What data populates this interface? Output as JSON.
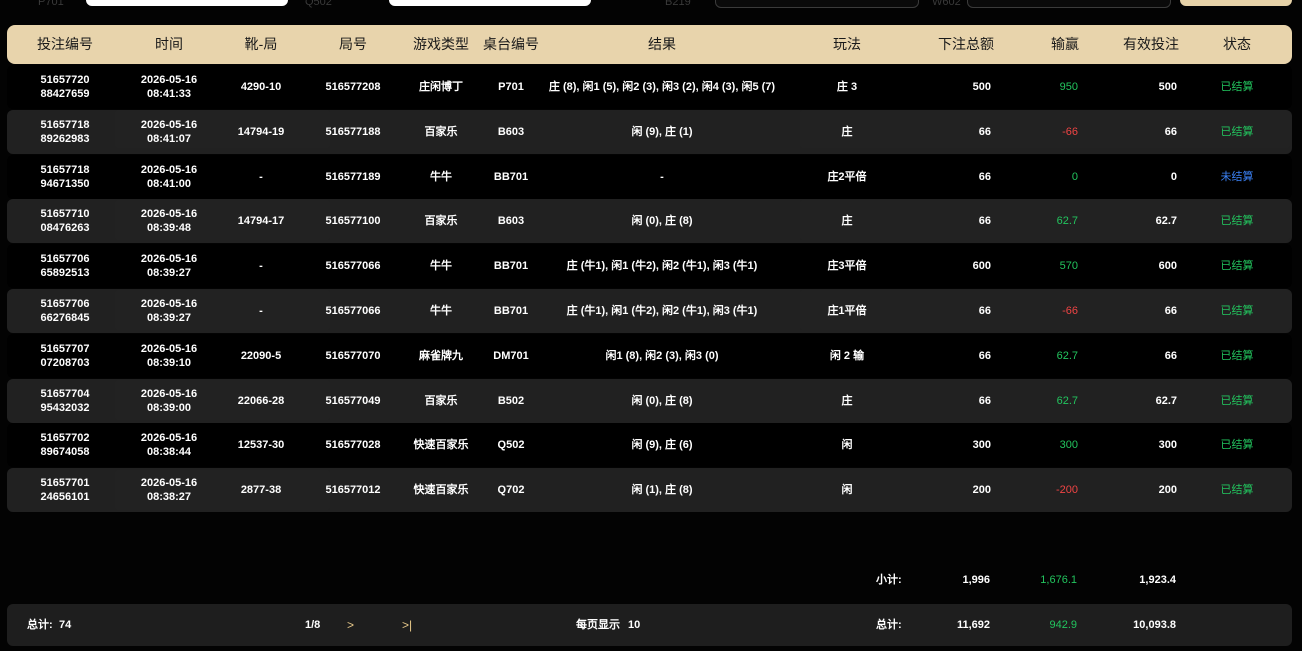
{
  "colors": {
    "header_bg": "#e8d4ac",
    "win": "#22c55e",
    "loss": "#ef4444",
    "pending": "#3b82f6",
    "settled": "#22c55e",
    "pager_accent": "#e8c98a"
  },
  "topbar": {
    "labels": [
      "P701",
      "Q502",
      "B219",
      "W602"
    ]
  },
  "columns": [
    "投注编号",
    "时间",
    "靴-局",
    "局号",
    "游戏类型",
    "桌台编号",
    "结果",
    "玩法",
    "下注总额",
    "输赢",
    "有效投注",
    "状态"
  ],
  "rows": [
    {
      "id1": "51657720",
      "id2": "88427659",
      "date": "2026-05-16",
      "time": "08:41:33",
      "shoe": "4290-10",
      "round": "516577208",
      "game": "庄闲博丁",
      "table": "P701",
      "result": "庄 (8), 闲1 (5), 闲2 (3), 闲3 (2), 闲4 (3), 闲5 (7)",
      "play": "庄 3",
      "total": "500",
      "winloss": "950",
      "wl_class": "pos",
      "valid": "500",
      "status": "已结算",
      "st_class": "st-done"
    },
    {
      "id1": "51657718",
      "id2": "89262983",
      "date": "2026-05-16",
      "time": "08:41:07",
      "shoe": "14794-19",
      "round": "516577188",
      "game": "百家乐",
      "table": "B603",
      "result": "闲 (9), 庄 (1)",
      "play": "庄",
      "total": "66",
      "winloss": "-66",
      "wl_class": "neg",
      "valid": "66",
      "status": "已结算",
      "st_class": "st-done"
    },
    {
      "id1": "51657718",
      "id2": "94671350",
      "date": "2026-05-16",
      "time": "08:41:00",
      "shoe": "-",
      "round": "516577189",
      "game": "牛牛",
      "table": "BB701",
      "result": "-",
      "play": "庄2平倍",
      "total": "66",
      "winloss": "0",
      "wl_class": "zero",
      "valid": "0",
      "status": "未结算",
      "st_class": "st-pending"
    },
    {
      "id1": "51657710",
      "id2": "08476263",
      "date": "2026-05-16",
      "time": "08:39:48",
      "shoe": "14794-17",
      "round": "516577100",
      "game": "百家乐",
      "table": "B603",
      "result": "闲 (0), 庄 (8)",
      "play": "庄",
      "total": "66",
      "winloss": "62.7",
      "wl_class": "pos",
      "valid": "62.7",
      "status": "已结算",
      "st_class": "st-done"
    },
    {
      "id1": "51657706",
      "id2": "65892513",
      "date": "2026-05-16",
      "time": "08:39:27",
      "shoe": "-",
      "round": "516577066",
      "game": "牛牛",
      "table": "BB701",
      "result": "庄 (牛1), 闲1 (牛2), 闲2 (牛1), 闲3 (牛1)",
      "play": "庄3平倍",
      "total": "600",
      "winloss": "570",
      "wl_class": "pos",
      "valid": "600",
      "status": "已结算",
      "st_class": "st-done"
    },
    {
      "id1": "51657706",
      "id2": "66276845",
      "date": "2026-05-16",
      "time": "08:39:27",
      "shoe": "-",
      "round": "516577066",
      "game": "牛牛",
      "table": "BB701",
      "result": "庄 (牛1), 闲1 (牛2), 闲2 (牛1), 闲3 (牛1)",
      "play": "庄1平倍",
      "total": "66",
      "winloss": "-66",
      "wl_class": "neg",
      "valid": "66",
      "status": "已结算",
      "st_class": "st-done"
    },
    {
      "id1": "51657707",
      "id2": "07208703",
      "date": "2026-05-16",
      "time": "08:39:10",
      "shoe": "22090-5",
      "round": "516577070",
      "game": "麻雀牌九",
      "table": "DM701",
      "result": "闲1 (8), 闲2 (3), 闲3 (0)",
      "play": "闲 2 输",
      "total": "66",
      "winloss": "62.7",
      "wl_class": "pos",
      "valid": "66",
      "status": "已结算",
      "st_class": "st-done"
    },
    {
      "id1": "51657704",
      "id2": "95432032",
      "date": "2026-05-16",
      "time": "08:39:00",
      "shoe": "22066-28",
      "round": "516577049",
      "game": "百家乐",
      "table": "B502",
      "result": "闲 (0), 庄 (8)",
      "play": "庄",
      "total": "66",
      "winloss": "62.7",
      "wl_class": "pos",
      "valid": "62.7",
      "status": "已结算",
      "st_class": "st-done"
    },
    {
      "id1": "51657702",
      "id2": "89674058",
      "date": "2026-05-16",
      "time": "08:38:44",
      "shoe": "12537-30",
      "round": "516577028",
      "game": "快速百家乐",
      "table": "Q502",
      "result": "闲 (9), 庄 (6)",
      "play": "闲",
      "total": "300",
      "winloss": "300",
      "wl_class": "pos",
      "valid": "300",
      "status": "已结算",
      "st_class": "st-done"
    },
    {
      "id1": "51657701",
      "id2": "24656101",
      "date": "2026-05-16",
      "time": "08:38:27",
      "shoe": "2877-38",
      "round": "516577012",
      "game": "快速百家乐",
      "table": "Q702",
      "result": "闲 (1), 庄 (8)",
      "play": "闲",
      "total": "200",
      "winloss": "-200",
      "wl_class": "neg",
      "valid": "200",
      "status": "已结算",
      "st_class": "st-done"
    }
  ],
  "subtotal": {
    "label": "小计:",
    "total": "1,996",
    "winloss": "1,676.1",
    "valid": "1,923.4"
  },
  "footer": {
    "count_label": "总计:",
    "count_value": "74",
    "page": "1/8",
    "next": ">",
    "last": ">|",
    "page_size_label": "每页显示",
    "page_size_value": "10",
    "total_label": "总计:",
    "total": "11,692",
    "winloss": "942.9",
    "valid": "10,093.8"
  }
}
